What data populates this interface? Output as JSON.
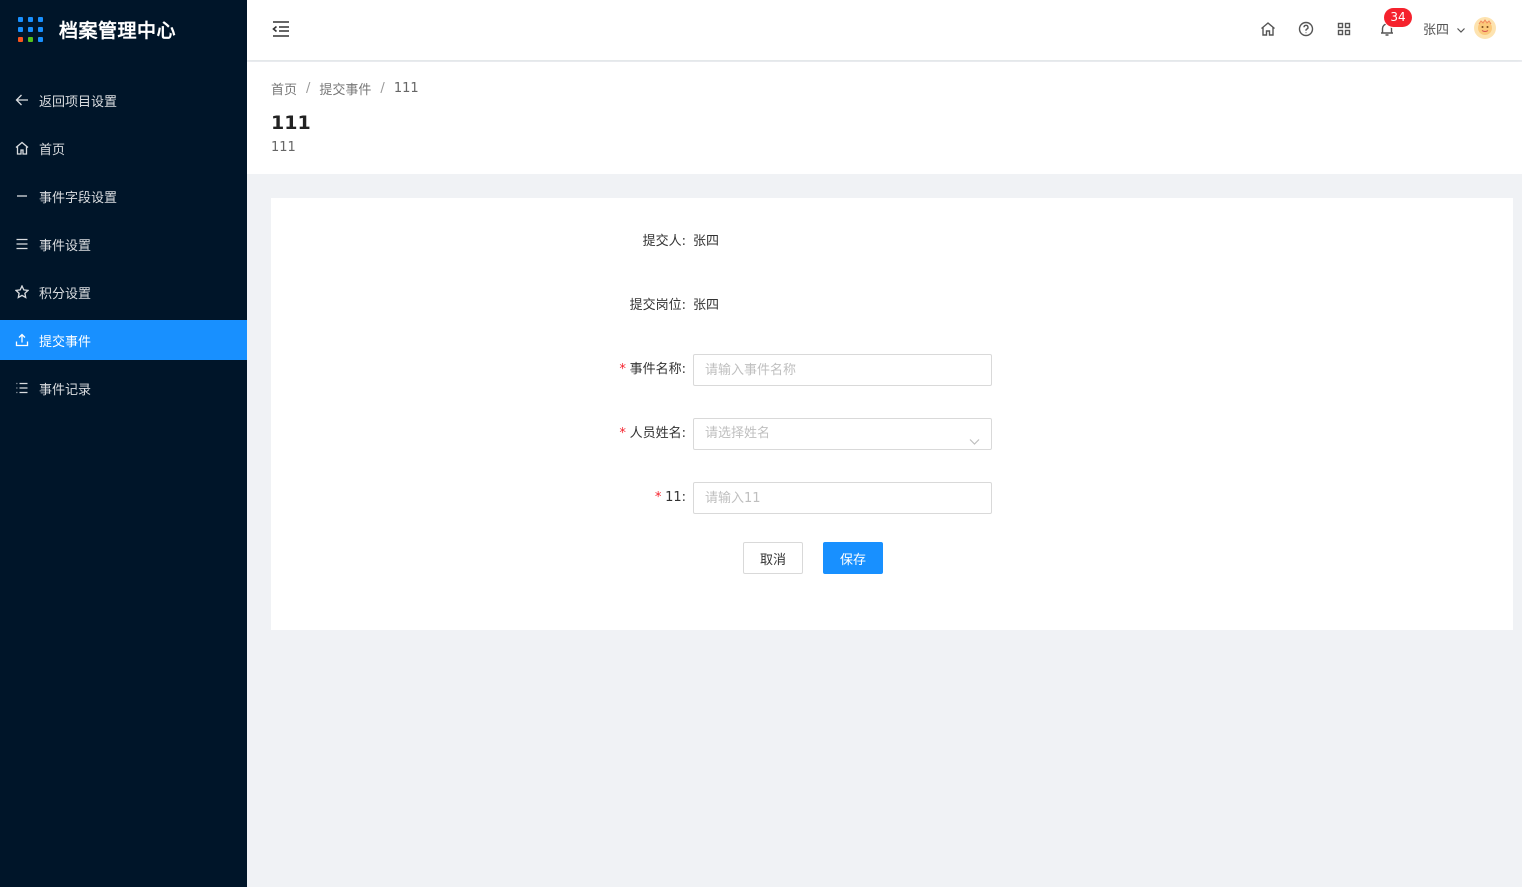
{
  "app": {
    "title": "档案管理中心",
    "brand_dot_colors": [
      "#1890ff",
      "#1890ff",
      "#1890ff",
      "#1890ff",
      "#1890ff",
      "#1890ff",
      "#fa541c",
      "#52c41a",
      "#1890ff"
    ]
  },
  "sidebar": {
    "items": [
      {
        "label": "返回项目设置",
        "icon": "arrow-left-icon"
      },
      {
        "label": "首页",
        "icon": "home-icon"
      },
      {
        "label": "事件字段设置",
        "icon": "minus-icon"
      },
      {
        "label": "事件设置",
        "icon": "menu-icon"
      },
      {
        "label": "积分设置",
        "icon": "star-icon"
      },
      {
        "label": "提交事件",
        "icon": "upload-icon",
        "active": true
      },
      {
        "label": "事件记录",
        "icon": "list-icon"
      }
    ]
  },
  "header": {
    "notification_count": "34",
    "user_name": "张四"
  },
  "page": {
    "breadcrumb": [
      "首页",
      "提交事件",
      "111"
    ],
    "title": "111",
    "subtitle": "111"
  },
  "form": {
    "submitter_label": "提交人:",
    "submitter_value": "张四",
    "position_label": "提交岗位:",
    "position_value": "张四",
    "event_name_label": "事件名称:",
    "event_name_placeholder": "请输入事件名称",
    "person_name_label": "人员姓名:",
    "person_name_placeholder": "请选择姓名",
    "field11_label": "11:",
    "field11_placeholder": "请输入11",
    "required_mark": "*",
    "cancel_label": "取消",
    "save_label": "保存"
  },
  "colors": {
    "sidebar_bg": "#001529",
    "accent": "#1890ff",
    "badge": "#f5222d"
  }
}
